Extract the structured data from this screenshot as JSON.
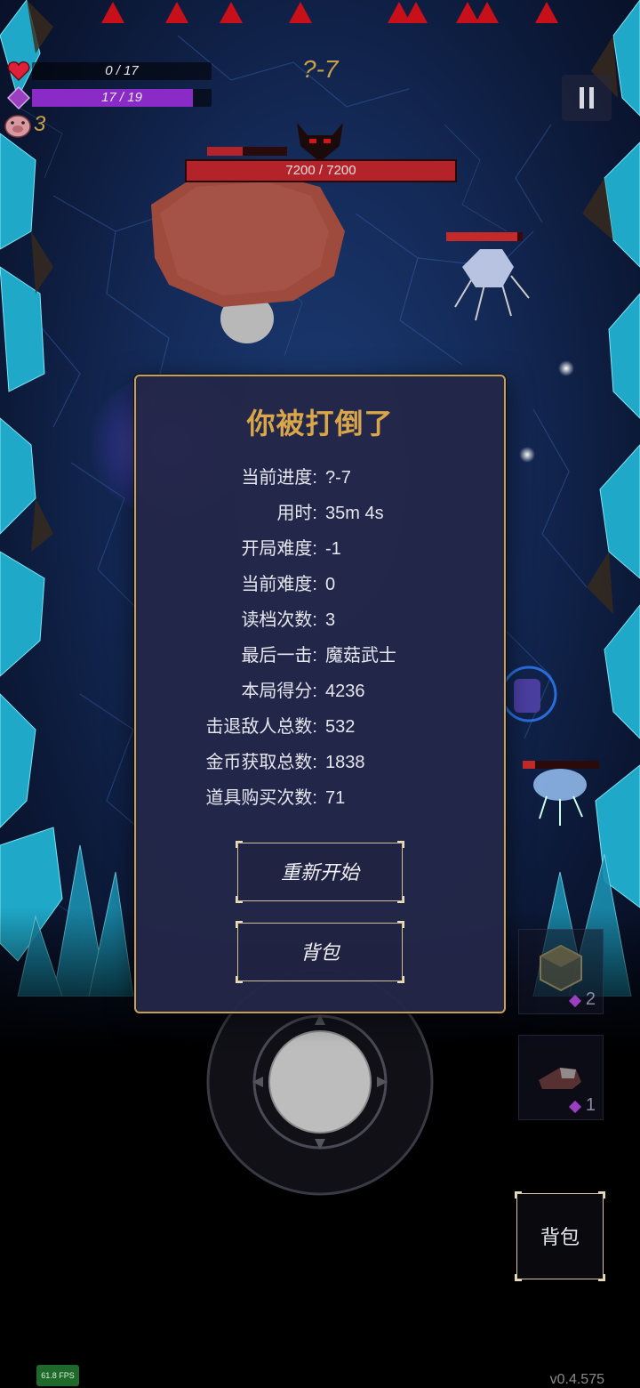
{
  "hud": {
    "health_text": "0 / 17",
    "health_fraction": 0,
    "mana_text": "17 / 19",
    "mana_fraction": 0.8947,
    "gold_count": "3",
    "stage_label": "?-7",
    "pause_icon": "pause-icon"
  },
  "boss": {
    "hp_text": "7200 / 7200",
    "hp_fraction": 1.0
  },
  "dialog": {
    "title": "你被打倒了",
    "stats": [
      {
        "label": "当前进度:",
        "value": "?-7"
      },
      {
        "label": "用时:",
        "value": "35m 4s"
      },
      {
        "label": "开局难度:",
        "value": "-1"
      },
      {
        "label": "当前难度:",
        "value": "0"
      },
      {
        "label": "读档次数:",
        "value": "3"
      },
      {
        "label": "最后一击:",
        "value": "魔菇武士"
      },
      {
        "label": "本局得分:",
        "value": "4236"
      },
      {
        "label": "击退敌人总数:",
        "value": "532"
      },
      {
        "label": "金币获取总数:",
        "value": "1838"
      },
      {
        "label": "道具购买次数:",
        "value": "71"
      }
    ],
    "restart_label": "重新开始",
    "backpack_label": "背包"
  },
  "items": [
    {
      "icon": "cube-item-icon",
      "count": "2"
    },
    {
      "icon": "boot-item-icon",
      "count": "1"
    }
  ],
  "backpack_button_label": "背包",
  "fps_text": "61.8 FPS",
  "version_text": "v0.4.575",
  "colors": {
    "accent_gold": "#c9a045",
    "dialog_border": "#c8a050",
    "health_red": "#b4222a",
    "mana_purple": "#8a2bc8"
  }
}
